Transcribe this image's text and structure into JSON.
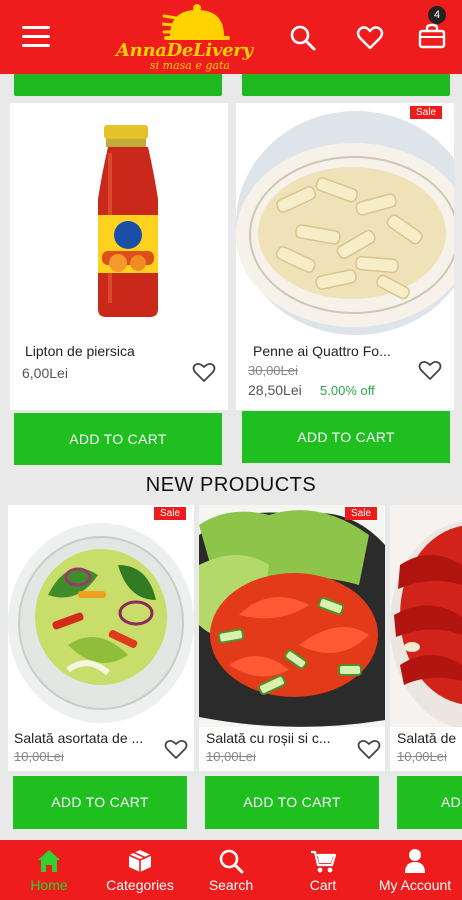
{
  "header": {
    "logo_main": "AnnaDeLivery",
    "logo_sub": "si masa e gata",
    "cart_count": "4"
  },
  "row1": [
    {
      "name": "Lipton de piersica",
      "price": "6,00Lei",
      "sale": "",
      "old_price": "",
      "discount": "",
      "button": "ADD TO CART"
    },
    {
      "name": "Penne ai Quattro Fo...",
      "price": "28,50Lei",
      "sale": "Sale",
      "old_price": "30,00Lei",
      "discount": "5.00% off",
      "button": "ADD TO CART"
    }
  ],
  "new_products": {
    "title": "NEW PRODUCTS",
    "items": [
      {
        "name": "Salată asortata de ...",
        "old_price": "10,00Lei",
        "sale": "Sale",
        "button": "ADD TO CART"
      },
      {
        "name": "Salată cu roșii si c...",
        "old_price": "10,00Lei",
        "sale": "Sale",
        "button": "ADD TO CART"
      },
      {
        "name": "Salată de",
        "old_price": "10,00Lei",
        "sale": "",
        "button": "AD"
      }
    ]
  },
  "bottom_nav": [
    {
      "label": "Home",
      "icon": "home-icon",
      "active": true
    },
    {
      "label": "Categories",
      "icon": "categories-icon",
      "active": false
    },
    {
      "label": "Search",
      "icon": "search-icon",
      "active": false
    },
    {
      "label": "Cart",
      "icon": "cart-icon",
      "active": false
    },
    {
      "label": "My Account",
      "icon": "account-icon",
      "active": false
    }
  ],
  "colors": {
    "brand_red": "#ee1c1c",
    "button_green": "#1fbf1f",
    "logo_yellow": "#ffd200",
    "active_nav": "#2fd02f"
  }
}
